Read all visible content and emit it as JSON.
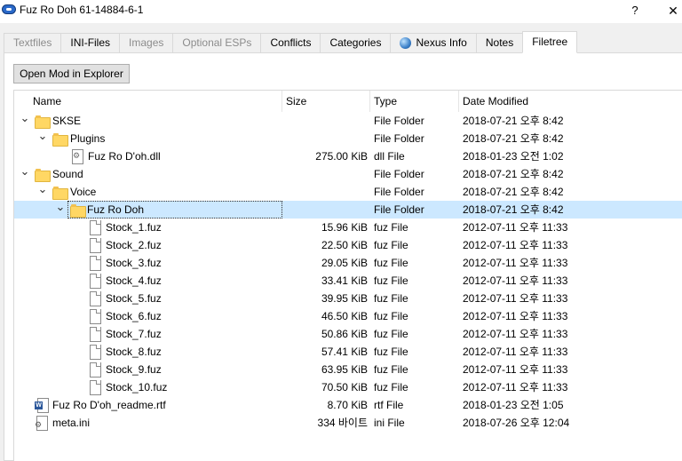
{
  "window": {
    "title": "Fuz Ro Doh 61-14884-6-1",
    "help_label": "?",
    "close_label": "✕"
  },
  "tabs": [
    {
      "label": "Textfiles",
      "enabled": false,
      "active": false
    },
    {
      "label": "INI-Files",
      "enabled": true,
      "active": false
    },
    {
      "label": "Images",
      "enabled": false,
      "active": false
    },
    {
      "label": "Optional ESPs",
      "enabled": false,
      "active": false
    },
    {
      "label": "Conflicts",
      "enabled": true,
      "active": false
    },
    {
      "label": "Categories",
      "enabled": true,
      "active": false
    },
    {
      "label": "Nexus Info",
      "enabled": true,
      "active": false,
      "icon": "globe-icon"
    },
    {
      "label": "Notes",
      "enabled": true,
      "active": false
    },
    {
      "label": "Filetree",
      "enabled": true,
      "active": true
    }
  ],
  "filetree": {
    "open_button_label": "Open Mod in Explorer",
    "columns": {
      "name": "Name",
      "size": "Size",
      "type": "Type",
      "date": "Date Modified"
    },
    "rows": [
      {
        "depth": 0,
        "expander": "expanded",
        "icon": "folder-icon",
        "name": "SKSE",
        "size": "",
        "type": "File Folder",
        "date": "2018-07-21 오후 8:42"
      },
      {
        "depth": 1,
        "expander": "expanded",
        "icon": "folder-icon",
        "name": "Plugins",
        "size": "",
        "type": "File Folder",
        "date": "2018-07-21 오후 8:42"
      },
      {
        "depth": 2,
        "expander": "none",
        "icon": "dll-file-icon",
        "name": "Fuz Ro D'oh.dll",
        "size": "275.00 KiB",
        "type": "dll File",
        "date": "2018-01-23 오전 1:02"
      },
      {
        "depth": 0,
        "expander": "expanded",
        "icon": "folder-icon",
        "name": "Sound",
        "size": "",
        "type": "File Folder",
        "date": "2018-07-21 오후 8:42"
      },
      {
        "depth": 1,
        "expander": "expanded",
        "icon": "folder-icon",
        "name": "Voice",
        "size": "",
        "type": "File Folder",
        "date": "2018-07-21 오후 8:42"
      },
      {
        "depth": 2,
        "expander": "expanded",
        "icon": "folder-icon",
        "name": "Fuz Ro Doh",
        "size": "",
        "type": "File Folder",
        "date": "2018-07-21 오후 8:42",
        "selected": true
      },
      {
        "depth": 3,
        "expander": "none",
        "icon": "file-icon",
        "name": "Stock_1.fuz",
        "size": "15.96 KiB",
        "type": "fuz File",
        "date": "2012-07-11 오후 11:33"
      },
      {
        "depth": 3,
        "expander": "none",
        "icon": "file-icon",
        "name": "Stock_2.fuz",
        "size": "22.50 KiB",
        "type": "fuz File",
        "date": "2012-07-11 오후 11:33"
      },
      {
        "depth": 3,
        "expander": "none",
        "icon": "file-icon",
        "name": "Stock_3.fuz",
        "size": "29.05 KiB",
        "type": "fuz File",
        "date": "2012-07-11 오후 11:33"
      },
      {
        "depth": 3,
        "expander": "none",
        "icon": "file-icon",
        "name": "Stock_4.fuz",
        "size": "33.41 KiB",
        "type": "fuz File",
        "date": "2012-07-11 오후 11:33"
      },
      {
        "depth": 3,
        "expander": "none",
        "icon": "file-icon",
        "name": "Stock_5.fuz",
        "size": "39.95 KiB",
        "type": "fuz File",
        "date": "2012-07-11 오후 11:33"
      },
      {
        "depth": 3,
        "expander": "none",
        "icon": "file-icon",
        "name": "Stock_6.fuz",
        "size": "46.50 KiB",
        "type": "fuz File",
        "date": "2012-07-11 오후 11:33"
      },
      {
        "depth": 3,
        "expander": "none",
        "icon": "file-icon",
        "name": "Stock_7.fuz",
        "size": "50.86 KiB",
        "type": "fuz File",
        "date": "2012-07-11 오후 11:33"
      },
      {
        "depth": 3,
        "expander": "none",
        "icon": "file-icon",
        "name": "Stock_8.fuz",
        "size": "57.41 KiB",
        "type": "fuz File",
        "date": "2012-07-11 오후 11:33"
      },
      {
        "depth": 3,
        "expander": "none",
        "icon": "file-icon",
        "name": "Stock_9.fuz",
        "size": "63.95 KiB",
        "type": "fuz File",
        "date": "2012-07-11 오후 11:33"
      },
      {
        "depth": 3,
        "expander": "none",
        "icon": "file-icon",
        "name": "Stock_10.fuz",
        "size": "70.50 KiB",
        "type": "fuz File",
        "date": "2012-07-11 오후 11:33"
      },
      {
        "depth": 0,
        "expander": "none",
        "icon": "rtf-file-icon",
        "name": "Fuz Ro D'oh_readme.rtf",
        "size": "8.70 KiB",
        "type": "rtf File",
        "date": "2018-01-23 오전 1:05"
      },
      {
        "depth": 0,
        "expander": "none",
        "icon": "ini-file-icon",
        "name": "meta.ini",
        "size": "334 바이트",
        "type": "ini File",
        "date": "2018-07-26 오후 12:04"
      }
    ]
  },
  "colors": {
    "selection": "#cce8ff",
    "dialog_background": "#f0f0f0",
    "folder": "#ffd764"
  }
}
